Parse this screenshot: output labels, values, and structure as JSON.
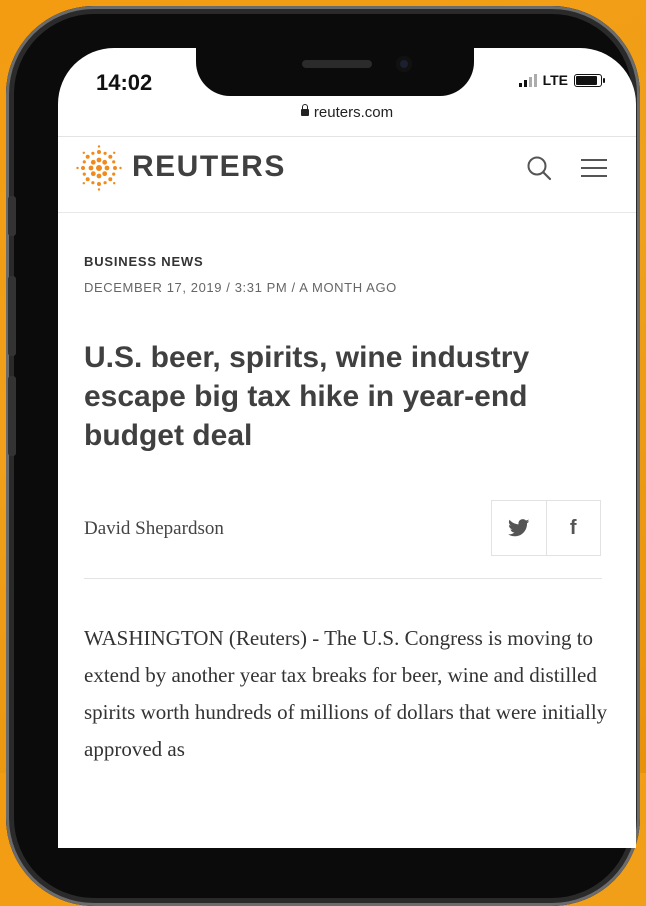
{
  "status_bar": {
    "time": "14:02",
    "network": "LTE"
  },
  "browser": {
    "url": "reuters.com"
  },
  "site": {
    "brand": "REUTERS"
  },
  "article": {
    "category": "BUSINESS NEWS",
    "dateline": "DECEMBER 17, 2019 / 3:31 PM / A MONTH AGO",
    "headline": "U.S. beer, spirits, wine industry escape big tax hike in year-end budget deal",
    "author": "David Shepardson",
    "body": "WASHINGTON (Reuters) - The U.S. Congress is moving to extend by another year tax breaks for beer, wine and distilled spirits worth hundreds of millions of dollars that were initially approved as"
  },
  "share": {
    "facebook_glyph": "f"
  },
  "icons": {
    "logo": "reuters-logo-icon",
    "search": "search-icon",
    "menu": "hamburger-menu-icon",
    "twitter": "twitter-icon",
    "facebook": "facebook-icon",
    "lock": "lock-icon"
  },
  "colors": {
    "background": "#f39c12",
    "brand_orange": "#f08a1c",
    "text_dark": "#404040"
  }
}
